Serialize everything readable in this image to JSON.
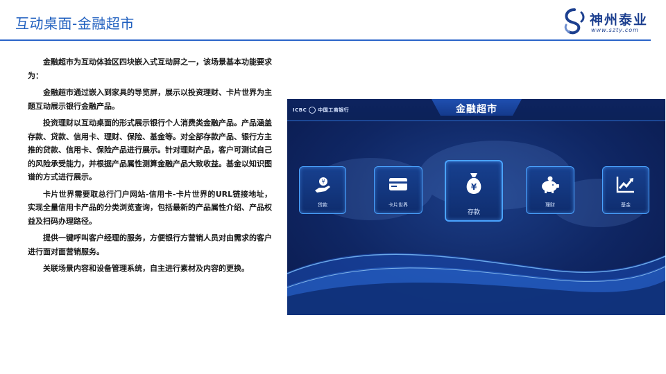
{
  "header": {
    "title": "互动桌面-金融超市",
    "logo_name": "神州泰业",
    "logo_url": "www.szty.com"
  },
  "paragraphs": [
    "金融超市为互动体验区四块嵌入式互动屏之一，该场景基本功能要求为：",
    "金融超市通过嵌入到家具的导览屏，展示以投资理财、卡片世界为主题互动展示银行金融产品。",
    "投资理财以互动桌面的形式展示银行个人消费类金融产品。产品涵盖存款、贷款、信用卡、理财、保险、基金等。对全部存款产品、银行方主推的贷款、信用卡、保险产品进行展示。针对理财产品，客户可测试自己的风险承受能力，并根据产品属性测算金融产品大致收益。基金以知识图谱的方式进行展示。",
    "卡片世界需要取总行门户网站-信用卡-卡片世界的URL链接地址，实现全量信用卡产品的分类浏览查询，包括最新的产品属性介绍、产品权益及扫码办理路径。",
    "提供一键呼叫客户经理的服务，方便银行方营销人员对由需求的客户进行面对面营销服务。",
    "关联场景内容和设备管理系统，自主进行素材及内容的更换。"
  ],
  "screen": {
    "bank_brand": "ICBC",
    "bank_name": "中国工商银行",
    "title": "金融超市",
    "tiles": [
      {
        "label": "贷款",
        "icon": "hand-coin-icon"
      },
      {
        "label": "卡片世界",
        "icon": "card-icon"
      },
      {
        "label": "存款",
        "icon": "money-bag-icon"
      },
      {
        "label": "理财",
        "icon": "piggy-bank-icon"
      },
      {
        "label": "基金",
        "icon": "trend-chart-icon"
      }
    ]
  },
  "colors": {
    "title_blue": "#1f5fbf",
    "screen_bg": "#0f2663",
    "tile_border": "#4aa3ff"
  }
}
